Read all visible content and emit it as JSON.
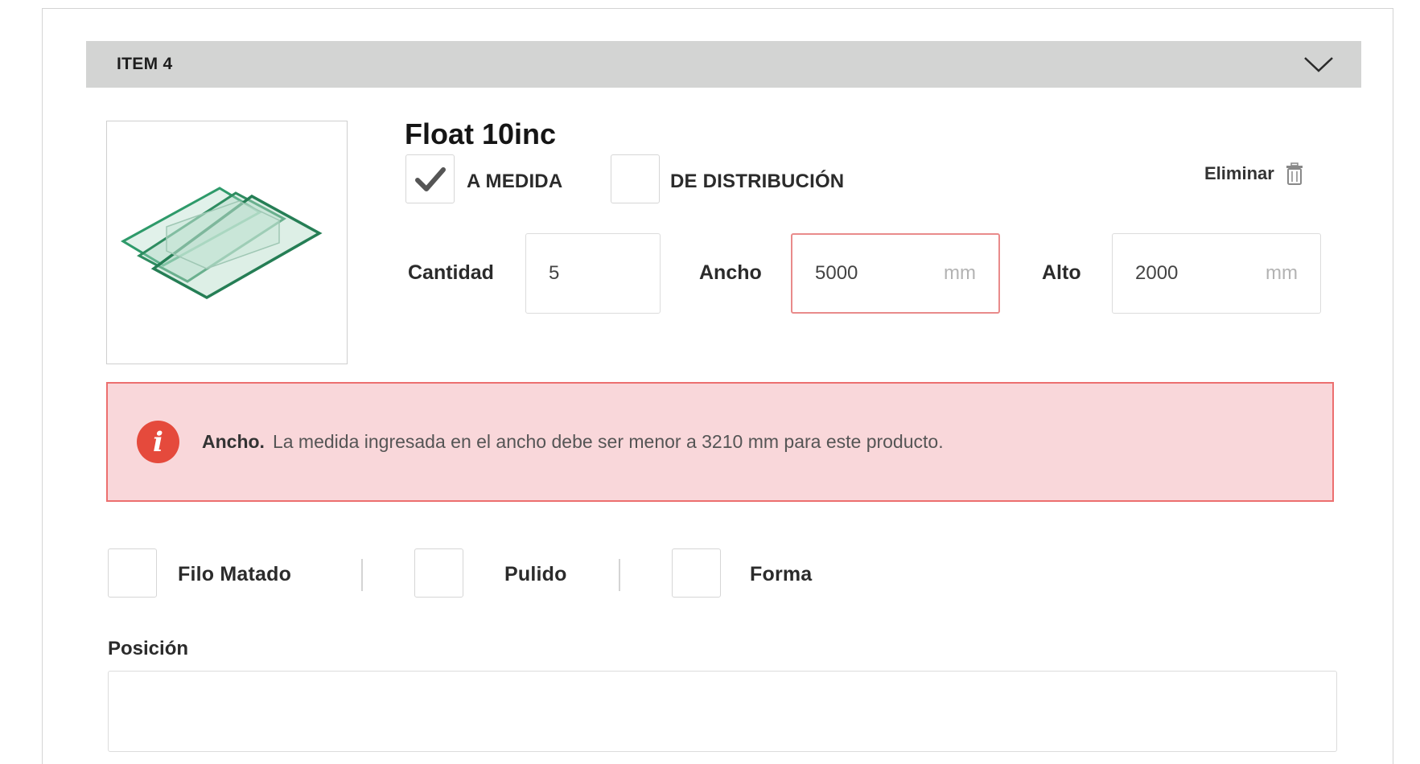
{
  "item": {
    "title": "ITEM 4"
  },
  "product": {
    "name": "Float 10inc"
  },
  "options": {
    "a_medida": {
      "label": "A MEDIDA",
      "checked": true
    },
    "de_distribucion": {
      "label": "DE DISTRIBUCIÓN",
      "checked": false
    }
  },
  "remove": {
    "label": "Eliminar"
  },
  "fields": {
    "cantidad": {
      "label": "Cantidad",
      "value": "5"
    },
    "ancho": {
      "label": "Ancho",
      "value": "5000",
      "unit": "mm"
    },
    "alto": {
      "label": "Alto",
      "value": "2000",
      "unit": "mm"
    }
  },
  "alert": {
    "title": "Ancho.",
    "message": "La medida ingresada en el ancho debe ser menor a 3210 mm para este producto."
  },
  "finishes": [
    {
      "label": "Filo Matado",
      "checked": false
    },
    {
      "label": "Pulido",
      "checked": false
    },
    {
      "label": "Forma",
      "checked": false
    }
  ],
  "position": {
    "label": "Posición",
    "value": ""
  },
  "colors": {
    "error_border": "#ec6f6f",
    "error_bg": "#f9d7da",
    "error_icon": "#e54a3c",
    "header_bg": "#d3d4d3"
  },
  "icons": {
    "chevron": "chevron-down-icon",
    "trash": "trash-icon",
    "check": "checkmark-icon",
    "info": "info-icon"
  }
}
